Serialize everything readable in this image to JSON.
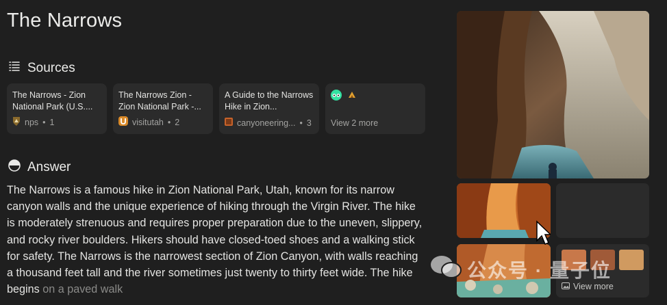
{
  "page": {
    "title": "The Narrows"
  },
  "sources": {
    "heading": "Sources",
    "cards": [
      {
        "title": "The Narrows - Zion National Park (U.S....",
        "site": "nps",
        "index": "1",
        "favicon_color": "#8a6a2c"
      },
      {
        "title": "The Narrows Zion - Zion National Park -...",
        "site": "visitutah",
        "index": "2",
        "favicon_color": "#d98a2a"
      },
      {
        "title": "A Guide to the Narrows Hike in Zion...",
        "site": "canyoneering...",
        "index": "3",
        "favicon_color": "#c8632a"
      }
    ],
    "more": {
      "label": "View 2 more"
    }
  },
  "answer": {
    "heading": "Answer",
    "text": "The Narrows is a famous hike in Zion National Park, Utah, known for its narrow canyon walls and the unique experience of hiking through the Virgin River. The hike is moderately strenuous and requires proper preparation due to the uneven, slippery, and rocky river boulders. Hikers should have closed-toed shoes and a walking stick for safety. The Narrows is the narrowest section of Zion Canyon, with walls reaching a thousand feet tall and the river sometimes just twenty to thirty feet wide. The hike begins",
    "faded_text": "on a paved walk"
  },
  "images": {
    "view_more_label": "View more"
  },
  "watermark": {
    "text": "公众号 · 量子位"
  }
}
